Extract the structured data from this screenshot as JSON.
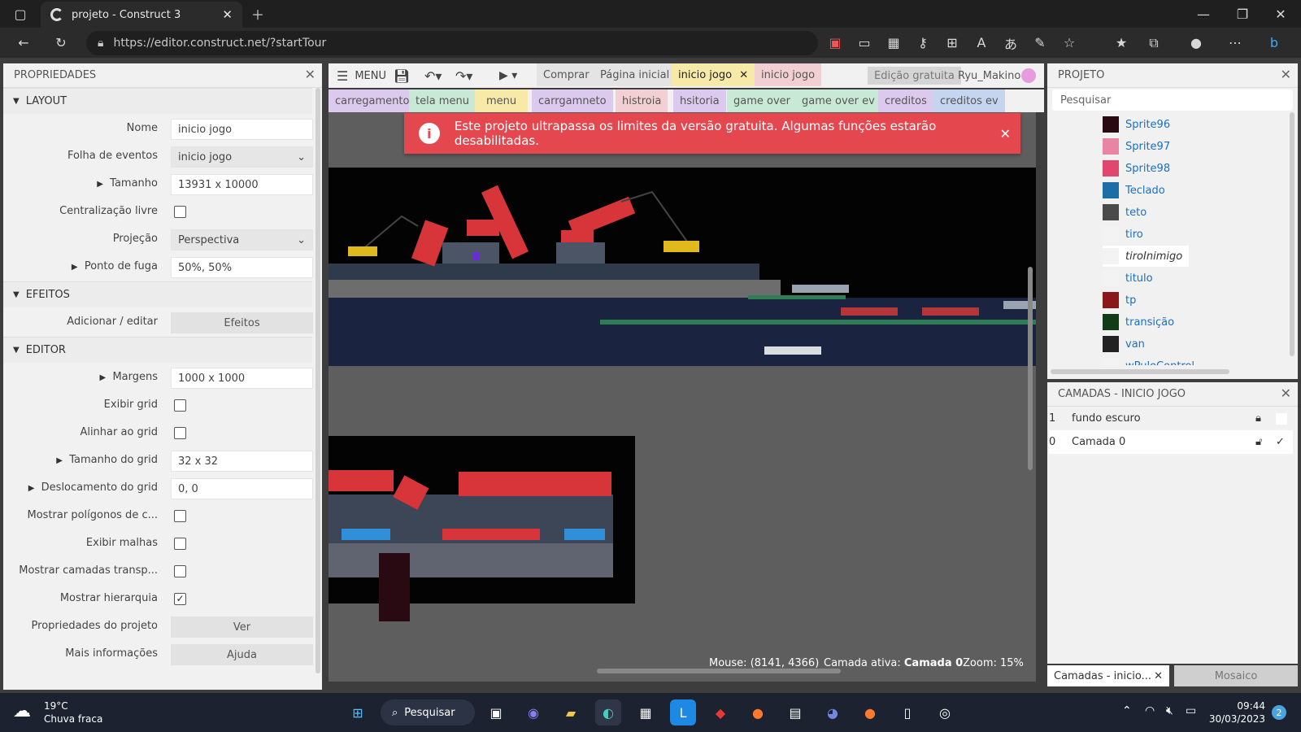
{
  "browser": {
    "tab_title": "projeto - Construct 3",
    "url": "https://editor.construct.net/?startTour"
  },
  "properties": {
    "title": "PROPRIEDADES",
    "sections": {
      "layout": "LAYOUT",
      "effects": "EFEITOS",
      "editor": "EDITOR"
    },
    "rows": [
      {
        "label": "Nome",
        "value": "inicio jogo"
      },
      {
        "label": "Folha de eventos",
        "value": "inicio jogo"
      },
      {
        "label": "Tamanho",
        "value": "13931 x 10000"
      },
      {
        "label": "Centralização livre",
        "checked": false
      },
      {
        "label": "Projeção",
        "value": "Perspectiva"
      },
      {
        "label": "Ponto de fuga",
        "value": "50%, 50%"
      },
      {
        "label": "Adicionar / editar",
        "value": "Efeitos"
      },
      {
        "label": "Margens",
        "value": "1000 x 1000"
      },
      {
        "label": "Exibir grid",
        "checked": false
      },
      {
        "label": "Alinhar ao grid",
        "checked": false
      },
      {
        "label": "Tamanho do grid",
        "value": "32 x 32"
      },
      {
        "label": "Deslocamento do grid",
        "value": "0, 0"
      },
      {
        "label": "Mostrar polígonos de c...",
        "checked": false
      },
      {
        "label": "Exibir malhas",
        "checked": false
      },
      {
        "label": "Mostrar camadas transp...",
        "checked": false
      },
      {
        "label": "Mostrar hierarquia",
        "checked": true
      },
      {
        "label": "Propriedades do projeto",
        "value": "Ver"
      },
      {
        "label": "Mais informações",
        "value": "Ajuda"
      }
    ]
  },
  "toolbar": {
    "menu": "MENU",
    "buy": "Comprar",
    "home": "Página inicial",
    "tab_active": "inicio jogo",
    "tab_events": "inicio jogo",
    "free_edition": "Edição gratuita",
    "user": "Ryu_Makino"
  },
  "layout_tabs": [
    "carregamento",
    "tela menu",
    "menu",
    "carrgamneto",
    "histroia",
    "hsitoria",
    "game over",
    "game over ev",
    "creditos",
    "creditos ev"
  ],
  "banner": {
    "text": "Este projeto ultrapassa os limites da versão gratuita. Algumas funções estarão desabilitadas."
  },
  "statusbar": {
    "mouse": "Mouse: (8141, 4366)",
    "active_layer_label": "Camada ativa:",
    "active_layer": "Camada 0",
    "zoom": "Zoom: 15%"
  },
  "project": {
    "title": "PROJETO",
    "search_placeholder": "Pesquisar",
    "objects": [
      {
        "name": "Sprite96",
        "color": "#2a0a12"
      },
      {
        "name": "Sprite97",
        "color": "#e884a4"
      },
      {
        "name": "Sprite98",
        "color": "#e0466e"
      },
      {
        "name": "Teclado",
        "color": "#1c6fa6"
      },
      {
        "name": "teto",
        "color": "#4a4a4a"
      },
      {
        "name": "tiro",
        "color": "#f3f3f3"
      },
      {
        "name": "tiroInimigo",
        "color": "#f3f3f3"
      },
      {
        "name": "titulo",
        "color": "#f3f3f3"
      },
      {
        "name": "tp",
        "color": "#8a1818"
      },
      {
        "name": "transição",
        "color": "#123b18"
      },
      {
        "name": "van",
        "color": "#222222"
      },
      {
        "name": "wPuloControl",
        "color": "#f3f3f3"
      }
    ]
  },
  "layers": {
    "title": "CAMADAS - INICIO JOGO",
    "rows": [
      {
        "index": "1",
        "name": "fundo escuro"
      },
      {
        "index": "0",
        "name": "Camada 0"
      }
    ],
    "bottom_tab": "Camadas - inicio...",
    "bottom_tab2": "Mosaico"
  },
  "taskbar": {
    "temp": "19°C",
    "weather": "Chuva fraca",
    "search": "Pesquisar",
    "time": "09:44",
    "date": "30/03/2023",
    "notif": "2"
  }
}
